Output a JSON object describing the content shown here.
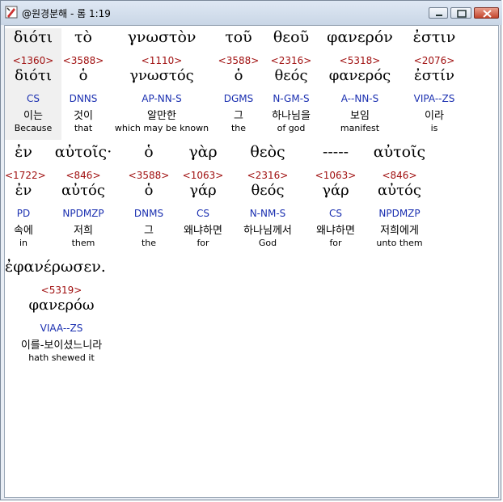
{
  "window": {
    "title": "@원경분해 - 롬 1:19"
  },
  "rows": [
    {
      "words": [
        {
          "greek": "διότι",
          "strong": "<1360>",
          "lemma": "διότι",
          "morph": "CS",
          "korean": "이는",
          "english": "Because",
          "selected": true
        },
        {
          "greek": "τὸ",
          "strong": "<3588>",
          "lemma": "ὁ",
          "morph": "DNNS",
          "korean": "것이",
          "english": "that"
        },
        {
          "greek": "γνωστὸν",
          "strong": "<1110>",
          "lemma": "γνωστός",
          "morph": "AP-NN-S",
          "korean": "알만한",
          "english": "which may be known"
        },
        {
          "greek": "τοῦ",
          "strong": "<3588>",
          "lemma": "ὁ",
          "morph": "DGMS",
          "korean": "그",
          "english": "the"
        },
        {
          "greek": "θεοῦ",
          "strong": "<2316>",
          "lemma": "θεός",
          "morph": "N-GM-S",
          "korean": "하나님을",
          "english": "of god"
        },
        {
          "greek": "φανερόν",
          "strong": "<5318>",
          "lemma": "φανερός",
          "morph": "A--NN-S",
          "korean": "보임",
          "english": "manifest"
        },
        {
          "greek": "ἐστιν",
          "strong": "<2076>",
          "lemma": "ἐστίν",
          "morph": "VIPA--ZS",
          "korean": "이라",
          "english": "is"
        }
      ]
    },
    {
      "words": [
        {
          "greek": "ἐν",
          "strong": "<1722>",
          "lemma": "ἐν",
          "morph": "PD",
          "korean": "속에",
          "english": "in"
        },
        {
          "greek": "αὐτοῖς·",
          "strong": "<846>",
          "lemma": "αὐτός",
          "morph": "NPDMZP",
          "korean": "저희",
          "english": "them"
        },
        {
          "greek": "ὁ",
          "strong": "<3588>",
          "lemma": "ὁ",
          "morph": "DNMS",
          "korean": "그",
          "english": "the"
        },
        {
          "greek": "γὰρ",
          "strong": "<1063>",
          "lemma": "γάρ",
          "morph": "CS",
          "korean": "왜냐하면",
          "english": "for"
        },
        {
          "greek": "θεὸς",
          "strong": "<2316>",
          "lemma": "θεός",
          "morph": "N-NM-S",
          "korean": "하나님께서",
          "english": "God"
        },
        {
          "greek": "-----",
          "strong": "<1063>",
          "lemma": "γάρ",
          "morph": "CS",
          "korean": "왜냐하면",
          "english": "for"
        },
        {
          "greek": "αὐτοῖς",
          "strong": "<846>",
          "lemma": "αὐτός",
          "morph": "NPDMZP",
          "korean": "저희에게",
          "english": "unto them"
        }
      ]
    },
    {
      "words": [
        {
          "greek": "ἐφανέρωσεν.",
          "strong": "<5319>",
          "lemma": "φανερόω",
          "morph": "VIAA--ZS",
          "korean": "이를-보이셨느니라",
          "english": "hath shewed it"
        }
      ]
    }
  ]
}
